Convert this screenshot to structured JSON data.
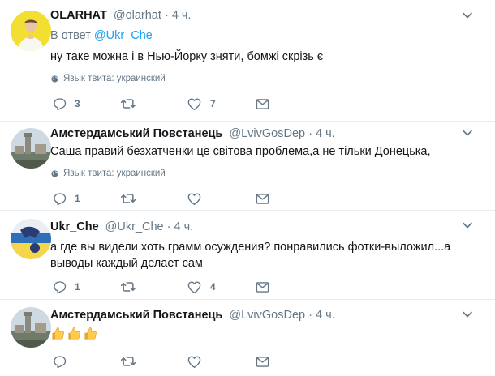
{
  "tweets": [
    {
      "name": "OLARHAT",
      "handle": "@olarhat",
      "dot": "·",
      "time": "4 ч.",
      "reply_prefix": "В ответ ",
      "reply_to": "@Ukr_Che",
      "text": "ну таке можна і в Нью-Йорку зняти, бомжі скрізь є",
      "lang": "Язык твита: украинский",
      "replies": "3",
      "retweets": "",
      "likes": "7"
    },
    {
      "name": "Амстердамський Повстанець",
      "handle": "@LvivGosDep",
      "dot": "·",
      "time": "4 ч.",
      "text": "Саша правий безхатченки це світова проблема,а не тільки Донецька,",
      "lang": "Язык твита: украинский",
      "replies": "1",
      "retweets": "",
      "likes": ""
    },
    {
      "name": "Ukr_Che",
      "handle": "@Ukr_Che",
      "dot": "·",
      "time": "4 ч.",
      "text": "а где вы видели хоть грамм осуждения? понравились фотки-выложил...а выводы каждый делает сам",
      "replies": "1",
      "retweets": "",
      "likes": "4"
    },
    {
      "name": "Амстердамський Повстанець",
      "handle": "@LvivGosDep",
      "dot": "·",
      "time": "4 ч.",
      "emoji": [
        "thumbs-up",
        "thumbs-up",
        "thumbs-up"
      ],
      "replies": "",
      "retweets": "",
      "likes": ""
    }
  ],
  "colors": {
    "name": "#14171a",
    "meta": "#657786",
    "link": "#1da1f2",
    "divider": "#e6ecf0"
  }
}
